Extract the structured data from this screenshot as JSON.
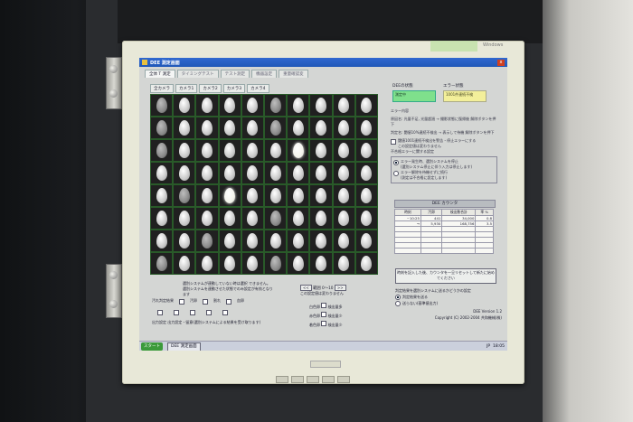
{
  "window": {
    "title": "DEE 測定画面",
    "close_label": "x"
  },
  "tabs": [
    {
      "label": "全体 T 測定",
      "active": true
    },
    {
      "label": "タイミングテスト",
      "active": false
    },
    {
      "label": "テスト測定",
      "active": false
    },
    {
      "label": "機器設定",
      "active": false
    },
    {
      "label": "重量確認変",
      "active": false
    }
  ],
  "camera_tabs": [
    "全カメラ",
    "カメラ1",
    "カメラ2",
    "カメラ3",
    "カメラ4"
  ],
  "status_panel": {
    "dee_label": "DEEの状態",
    "dee_value": "測定中",
    "error_label": "エラー状態",
    "error_value": "1001件連続不検",
    "error_content_label": "エラー内容"
  },
  "notes": {
    "cause": "原因名: 光量不足, 光量超過 → 撮影状態に復帰後 解除ボタンを押下",
    "judgement": "判定名: 閾値10%連続不検出 → 表示して待機 解除ボタンを押下",
    "option_consecutive": "閾値1001連続不検出を警告・停止エラーにする",
    "option_consecutive_sub": "この設定値は変わりません",
    "group_title": "不合格エラーに関する設定",
    "opt_stop": "エラー発生時、選別システムを停止",
    "opt_stop_sub": "(選別システム停止に伴う入力は停止します)",
    "opt_continue": "エラー解除を待機せずに続行",
    "opt_continue_sub": "(測定は不合格に設定します)"
  },
  "dee_counter": {
    "title": "DEE カウンタ",
    "headers": [
      "時刻",
      "汚卵",
      "検出数合計",
      "率 %"
    ],
    "rows": [
      [
        "~10:25",
        "441",
        "34,000",
        "0.8"
      ],
      [
        "→",
        "5,930",
        "168,756",
        "3.5"
      ],
      [
        "",
        "",
        "",
        ""
      ],
      [
        "",
        "",
        "",
        ""
      ],
      [
        "",
        "",
        "",
        ""
      ]
    ]
  },
  "reset_button": "時刻を記入した後、カウンタを一旦リセットして新たに始めてください",
  "bottom_left": {
    "msg1": "選別システムが連動していない時は選択 できません。",
    "msg2": "選別システムを連動させた状態でのみ設定が有効となります",
    "label_judge": "汚れ判定結果",
    "label_output": "出力設定",
    "col_labels": [
      "汚卵",
      "割れ",
      "血卵"
    ],
    "legend": "出力設定・留意(選別システムによる結果を受け取ります)"
  },
  "bottom_mid": {
    "nav_prev": "<<",
    "nav_label": "範囲 0〜10",
    "nav_next": ">>",
    "sub": "この設定値は変わりません",
    "rows": [
      "白色卵",
      "赤色卵",
      "着色卵"
    ],
    "right_labels": [
      "検出量多",
      "検出量少",
      "検出量少"
    ]
  },
  "bottom_right": {
    "title": "判定結果を選別システムに送るかどうかの設定",
    "opt1": "判定結果を送る",
    "opt2": "送らない(基準値出力)",
    "version": "DEE Version 1.2",
    "copyright": "Copyright (C) 2002-2004 共和機械(株)"
  },
  "taskbar": {
    "start": "スタート",
    "task": "DEE 測定画面",
    "lang": "JP",
    "time": "18:05"
  },
  "bezel": {
    "brand": "Windows"
  }
}
